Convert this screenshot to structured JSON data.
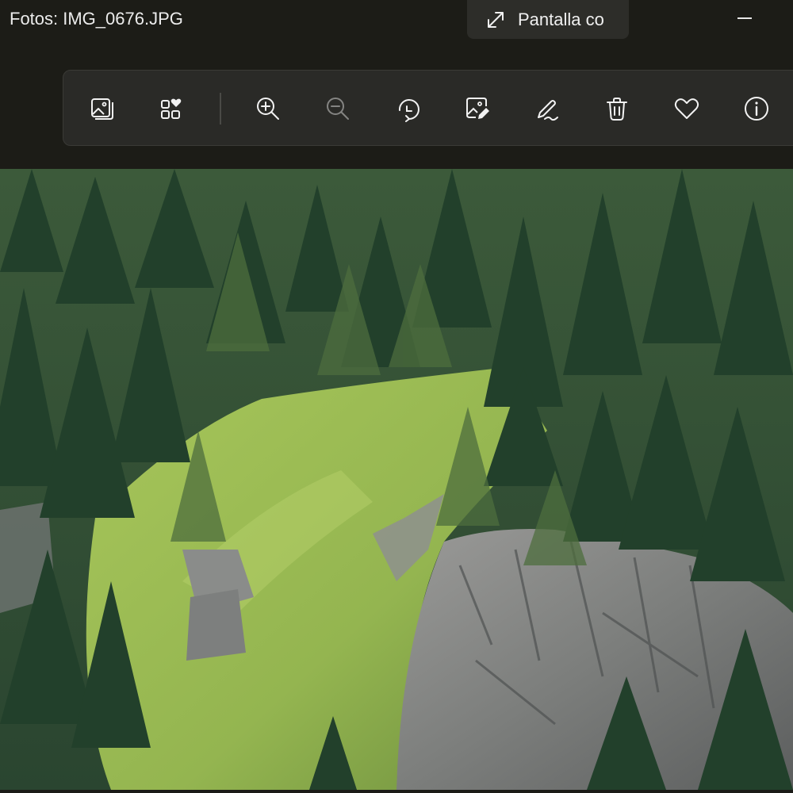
{
  "window": {
    "title": "Fotos: IMG_0676.JPG",
    "fullscreen_label": "Pantalla co"
  },
  "toolbar": {
    "tools": [
      {
        "name": "gallery-icon",
        "enabled": true
      },
      {
        "name": "collections-icon",
        "enabled": true
      },
      {
        "name": "zoom-in-icon",
        "enabled": true
      },
      {
        "name": "zoom-out-icon",
        "enabled": false
      },
      {
        "name": "rotate-icon",
        "enabled": true
      },
      {
        "name": "edit-image-icon",
        "enabled": true
      },
      {
        "name": "draw-icon",
        "enabled": true
      },
      {
        "name": "delete-icon",
        "enabled": true
      },
      {
        "name": "favorite-icon",
        "enabled": true
      },
      {
        "name": "info-icon",
        "enabled": true
      }
    ]
  },
  "photo": {
    "subject": "alpine-forest-slope",
    "colors": {
      "sky_shadow": "#2f4a2c",
      "grass": "#9cbc52",
      "rock": "#8c8e8c",
      "tree": "#24402a"
    }
  }
}
